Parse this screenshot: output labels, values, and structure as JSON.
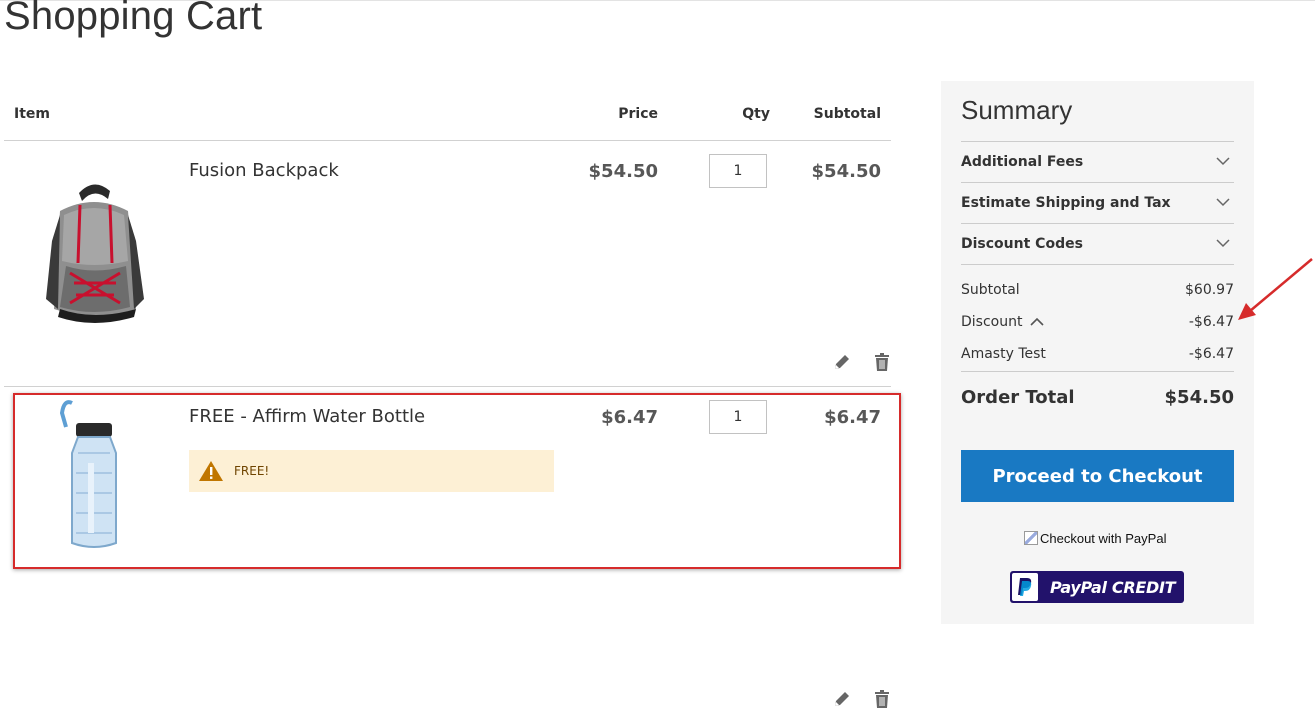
{
  "page": {
    "title": "Shopping Cart"
  },
  "cart": {
    "headers": {
      "item": "Item",
      "price": "Price",
      "qty": "Qty",
      "subtotal": "Subtotal"
    },
    "items": [
      {
        "name": "Fusion Backpack",
        "price": "$54.50",
        "qty": "1",
        "subtotal": "$54.50",
        "image_icon": "backpack-image"
      },
      {
        "name": "FREE - Affirm Water Bottle",
        "price": "$6.47",
        "qty": "1",
        "subtotal": "$6.47",
        "image_icon": "water-bottle-image",
        "notice": "FREE!"
      }
    ],
    "action_icons": [
      "pencil-icon",
      "trash-icon"
    ]
  },
  "summary": {
    "title": "Summary",
    "sections": [
      {
        "label": "Additional Fees"
      },
      {
        "label": "Estimate Shipping and Tax"
      },
      {
        "label": "Discount Codes"
      }
    ],
    "totals": {
      "subtotal_label": "Subtotal",
      "subtotal_value": "$60.97",
      "discount_label": "Discount",
      "discount_value": "-$6.47",
      "amasty_label": "Amasty Test",
      "amasty_value": "-$6.47",
      "order_total_label": "Order Total",
      "order_total_value": "$54.50"
    },
    "checkout_button": "Proceed to Checkout",
    "paypal_alt": "Checkout with PayPal",
    "paypal_credit": "PayPal CREDIT"
  },
  "colors": {
    "primary_button": "#1979c3",
    "highlight_border": "#d62b2b",
    "notice_bg": "#fdf0d5",
    "paypal_navy": "#22126b"
  }
}
